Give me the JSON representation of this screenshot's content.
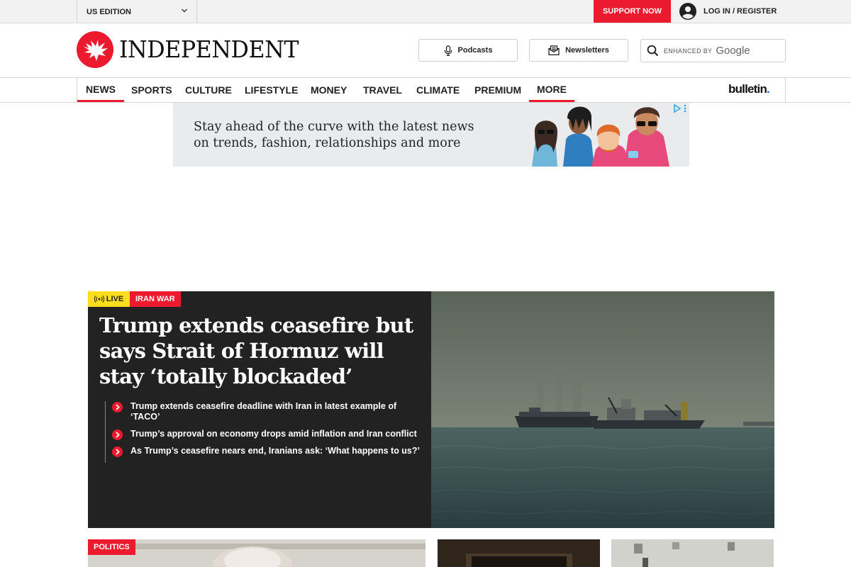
{
  "topbar": {
    "edition_label": "US EDITION",
    "support_label": "SUPPORT NOW",
    "login_label": "LOG IN / REGISTER"
  },
  "masthead": {
    "logo_text": "INDEPENDENT",
    "podcasts_label": "Podcasts",
    "newsletters_label": "Newsletters",
    "search_enhanced": "ENHANCED BY",
    "search_google": "Google"
  },
  "nav": {
    "items": [
      {
        "label": "NEWS",
        "active": true
      },
      {
        "label": "SPORTS"
      },
      {
        "label": "CULTURE"
      },
      {
        "label": "LIFESTYLE"
      },
      {
        "label": "MONEY"
      },
      {
        "label": "TRAVEL"
      },
      {
        "label": "CLIMATE"
      },
      {
        "label": "PREMIUM"
      },
      {
        "label": "MORE",
        "active": true
      }
    ],
    "bulletin_label": "bulletin",
    "bulletin_dot": "."
  },
  "ad": {
    "line1": "Stay ahead of the curve with the latest news",
    "line2": "on trends, fashion, relationships and more"
  },
  "hero": {
    "live_label": "LIVE",
    "category_label": "IRAN WAR",
    "title": "Trump extends ceasefire but says Strait of Hormuz will stay ‘totally blockaded’",
    "related": [
      "Trump extends ceasefire deadline with Iran in latest example of ‘TACO’",
      "Trump’s approval on economy drops amid inflation and Iran conflict",
      "As Trump’s ceasefire nears end, Iranians ask: ‘What happens to us?’"
    ]
  },
  "cards": {
    "politics_label": "POLITICS"
  },
  "colors": {
    "brand_red": "#ec1a2e",
    "live_yellow": "#fdde1e",
    "hero_bg": "#222222"
  }
}
